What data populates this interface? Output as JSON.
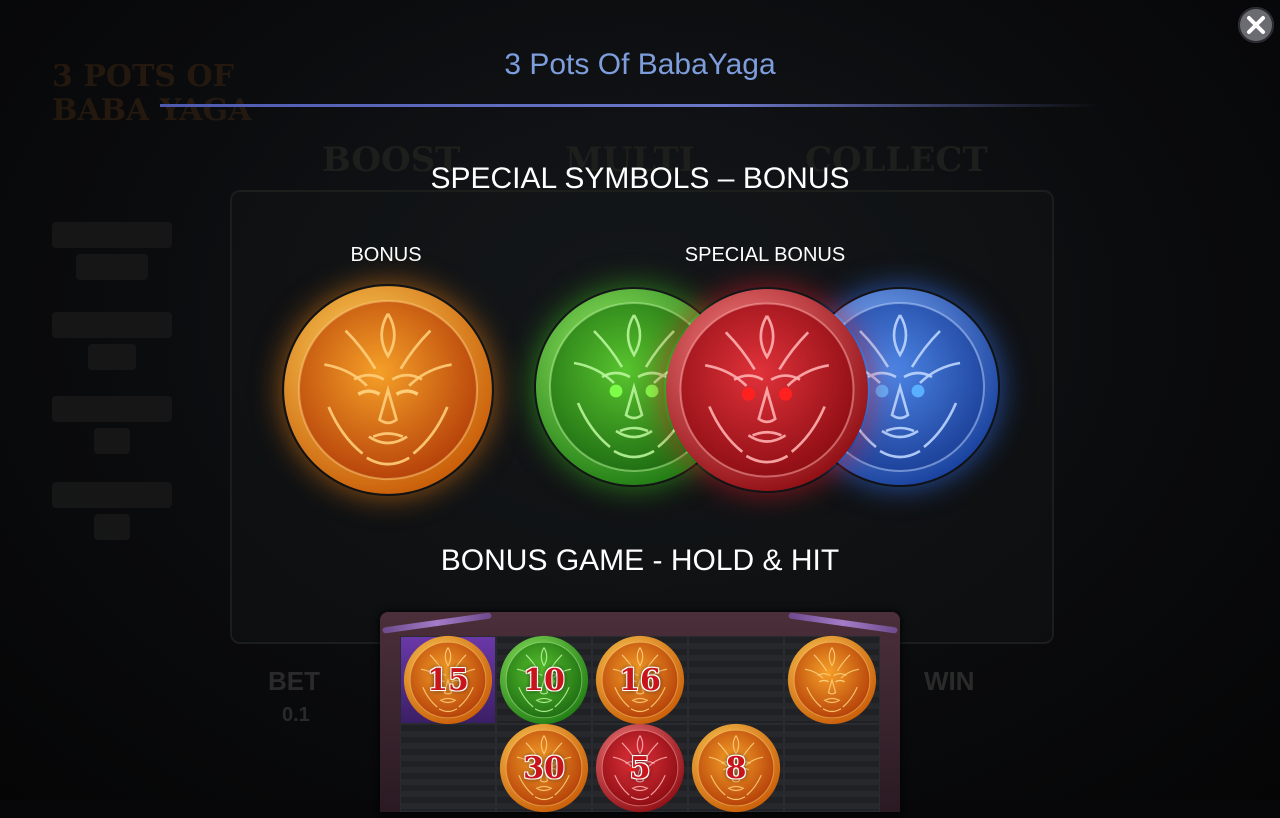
{
  "window": {
    "title": "3 Pots Of BabaYaga",
    "close_icon": "close-icon"
  },
  "background": {
    "logo_text": "3 POTS OF BABA YAGA",
    "words": [
      "BOOST",
      "MULTI",
      "COLLECT"
    ],
    "bet_label": "BET",
    "bet_value": "0.1",
    "win_label": "WIN"
  },
  "sections": {
    "special_symbols_heading": "SPECIAL SYMBOLS – BONUS",
    "bonus_label": "BONUS",
    "special_bonus_label": "SPECIAL BONUS",
    "bonus_game_heading": "BONUS GAME - HOLD & HIT"
  },
  "symbols": {
    "bonus": {
      "name": "orange-coin",
      "color": "#f08a1c"
    },
    "special": [
      {
        "name": "green-coin",
        "color": "#3fb41e"
      },
      {
        "name": "red-coin",
        "color": "#d4202a"
      },
      {
        "name": "blue-coin",
        "color": "#2f6fd8"
      }
    ]
  },
  "hold_and_hit_grid": {
    "rows": [
      [
        {
          "coin": "orange",
          "value": "15",
          "cell": "purple"
        },
        {
          "coin": "green",
          "value": "10",
          "cell": "dark"
        },
        {
          "coin": "orange",
          "value": "16",
          "cell": "dark"
        },
        {
          "coin": "",
          "value": "",
          "cell": "dark"
        },
        {
          "coin": "orange",
          "value": "",
          "cell": "dark"
        }
      ],
      [
        {
          "coin": "",
          "value": "",
          "cell": "dark"
        },
        {
          "coin": "orange",
          "value": "30",
          "cell": "dark"
        },
        {
          "coin": "red",
          "value": "5",
          "cell": "dark"
        },
        {
          "coin": "orange",
          "value": "8",
          "cell": "dark"
        },
        {
          "coin": "",
          "value": "",
          "cell": "dark"
        }
      ]
    ]
  },
  "colors": {
    "title": "#7d9ddc",
    "divider": "#5a66bd",
    "heading": "#ffffff",
    "orange": "#f08a1c",
    "green": "#3fb41e",
    "red": "#d4202a",
    "blue": "#2f6fd8"
  }
}
